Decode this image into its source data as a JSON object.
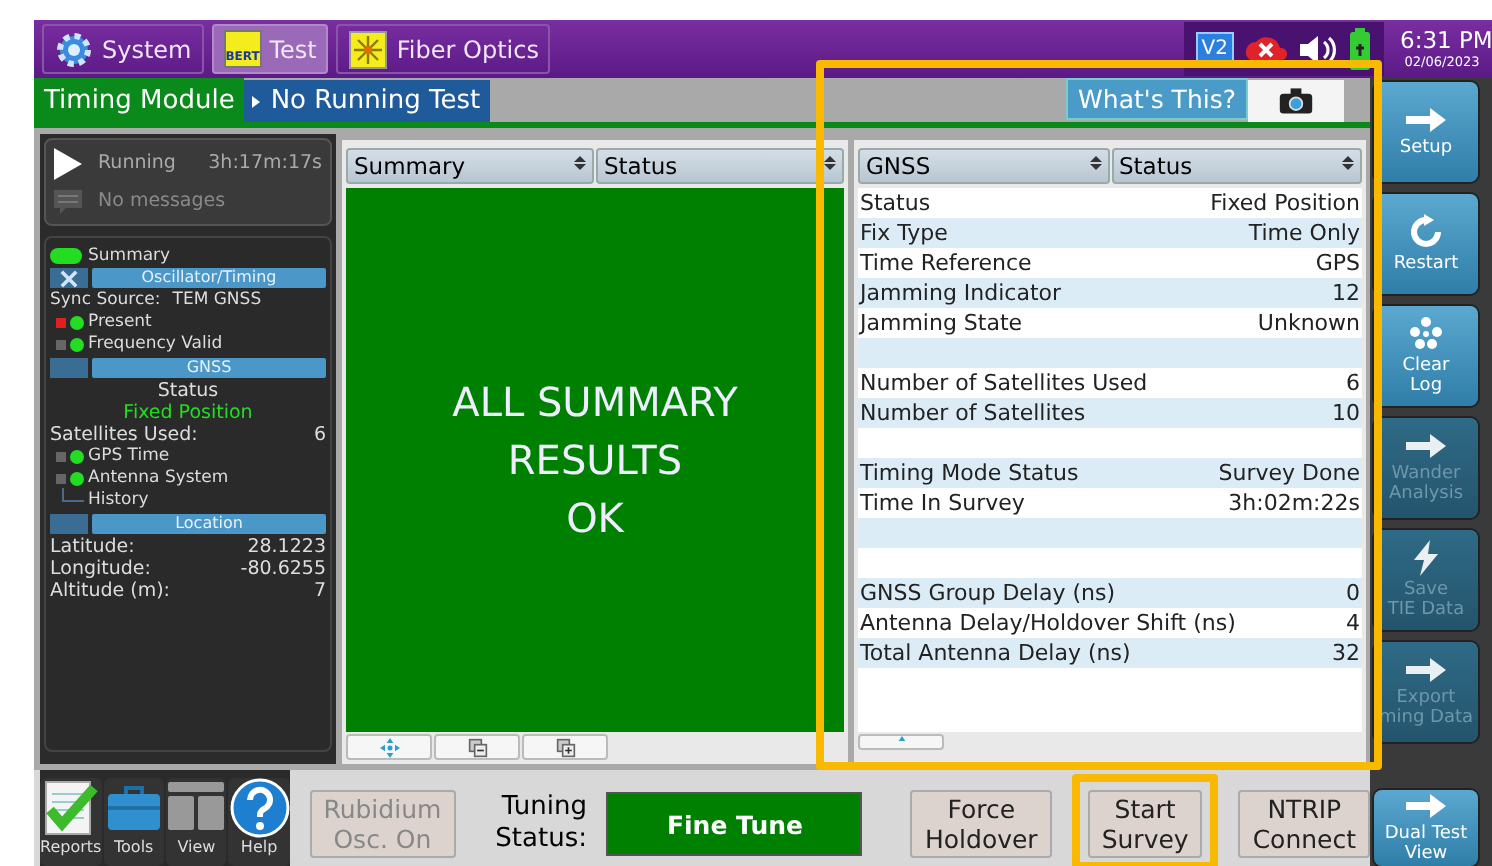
{
  "top_bar": {
    "apps": [
      {
        "label": "System",
        "selected": false
      },
      {
        "label": "Test",
        "icon_text": "BERT",
        "selected": true
      },
      {
        "label": "Fiber Optics",
        "selected": false
      }
    ],
    "badge": "V2",
    "time": "6:31 PM",
    "date": "02/06/2023"
  },
  "tabs": [
    {
      "label": "Timing Module",
      "kind": "module"
    },
    {
      "label": "No Running Test",
      "kind": "test"
    }
  ],
  "whats_this": "What's This?",
  "run_status": {
    "state": "Running",
    "elapsed": "3h:17m:17s",
    "messages": "No messages"
  },
  "summary": {
    "label": "Summary",
    "on": true
  },
  "sections": [
    {
      "title": "Oscillator/Timing",
      "closable": true,
      "items": [
        {
          "kind": "line",
          "label": "Sync Source:",
          "value": "TEM GNSS"
        },
        {
          "kind": "led",
          "label": "Present",
          "on": true,
          "alarm_history": true
        },
        {
          "kind": "led",
          "label": "Frequency Valid",
          "on": true,
          "alarm_history": false
        }
      ]
    },
    {
      "title": "GNSS",
      "closable": false,
      "items": [
        {
          "kind": "center",
          "label": "Status"
        },
        {
          "kind": "result",
          "label": "Fixed Position"
        },
        {
          "kind": "pair",
          "label": "Satellites Used:",
          "value": "6"
        },
        {
          "kind": "led",
          "label": "GPS Time",
          "on": true,
          "alarm_history": false
        },
        {
          "kind": "led",
          "label": "Antenna System",
          "on": true,
          "alarm_history": false
        },
        {
          "kind": "link",
          "label": "History"
        }
      ]
    },
    {
      "title": "Location",
      "closable": false,
      "items": [
        {
          "kind": "pair",
          "label": "Latitude:",
          "value": "28.1223"
        },
        {
          "kind": "pair",
          "label": "Longitude:",
          "value": "-80.6255"
        },
        {
          "kind": "pair",
          "label": "Altitude (m):",
          "value": "7"
        }
      ]
    }
  ],
  "summary_panel": {
    "selectors": [
      "Summary",
      "Status"
    ],
    "message": "ALL SUMMARY\nRESULTS\nOK",
    "passed": true
  },
  "gnss_panel": {
    "selectors": [
      "GNSS",
      "Status"
    ],
    "highlighted": true,
    "rows": [
      {
        "kind": "row",
        "label": "Status",
        "value": "Fixed Position"
      },
      {
        "kind": "row",
        "label": "Fix Type",
        "value": "Time Only"
      },
      {
        "kind": "row",
        "label": "Time Reference",
        "value": "GPS"
      },
      {
        "kind": "row",
        "label": "Jamming Indicator",
        "value": "12"
      },
      {
        "kind": "row",
        "label": "Jamming State",
        "value": "Unknown"
      },
      {
        "kind": "blank"
      },
      {
        "kind": "row",
        "label": "Number of Satellites Used",
        "value": "6"
      },
      {
        "kind": "row",
        "label": "Number of Satellites",
        "value": "10"
      },
      {
        "kind": "blank"
      },
      {
        "kind": "row",
        "label": "Timing Mode Status",
        "value": "Survey Done"
      },
      {
        "kind": "row",
        "label": "Time In Survey",
        "value": "3h:02m:22s"
      },
      {
        "kind": "blank"
      },
      {
        "kind": "blank"
      },
      {
        "kind": "row",
        "label": "GNSS Group Delay (ns)",
        "value": "0"
      },
      {
        "kind": "row",
        "label": "Antenna Delay/Holdover Shift (ns)",
        "value": "4"
      },
      {
        "kind": "row",
        "label": "Total Antenna Delay (ns)",
        "value": "32"
      }
    ]
  },
  "side_buttons": [
    {
      "label": "Setup",
      "disabled": false
    },
    {
      "label": "Restart",
      "disabled": false
    },
    {
      "label": "Clear\nLog",
      "disabled": false
    },
    {
      "label": "Wander\nAnalysis",
      "disabled": true
    },
    {
      "label": "Save\nTIE Data",
      "disabled": true
    },
    {
      "label": "Export\nming Data",
      "disabled": true
    }
  ],
  "dual_view": {
    "label": "Dual Test\nView"
  },
  "tools": [
    {
      "label": "Reports"
    },
    {
      "label": "Tools"
    },
    {
      "label": "View"
    },
    {
      "label": "Help"
    }
  ],
  "actions": [
    {
      "kind": "button",
      "label": "Rubidium\nOsc. On",
      "disabled": true,
      "highlighted": false
    },
    {
      "kind": "label",
      "label": "Tuning\nStatus:"
    },
    {
      "kind": "indicator",
      "label": "Fine Tune"
    },
    {
      "kind": "button",
      "label": "Force\nHoldover",
      "disabled": false,
      "highlighted": false
    },
    {
      "kind": "button",
      "label": "Start\nSurvey",
      "disabled": false,
      "highlighted": true
    },
    {
      "kind": "button",
      "label": "NTRIP\nConnect",
      "disabled": false,
      "highlighted": false
    }
  ]
}
